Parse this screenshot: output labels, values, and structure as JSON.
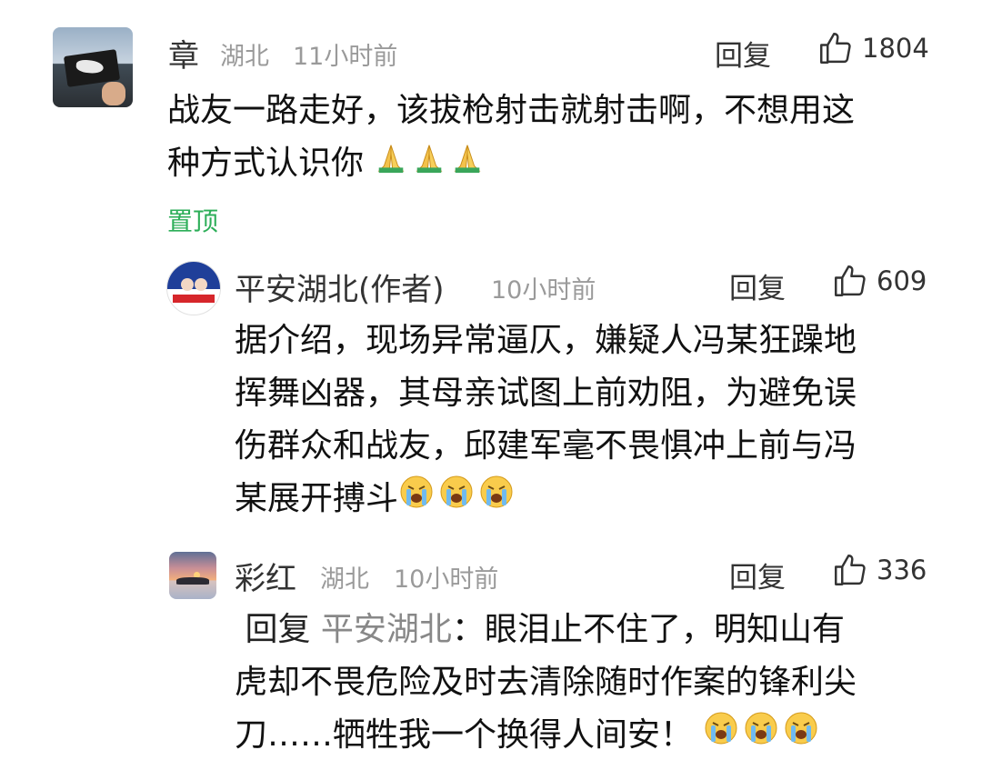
{
  "comments": [
    {
      "username": "章",
      "location": "湖北",
      "time": "11小时前",
      "reply_label": "回复",
      "likes": "1804",
      "content_lines": [
        "战友一路走好，该拔枪射击就射击啊，不想用这",
        "种方式认识你"
      ],
      "emoji": "pray-emoji",
      "emoji_count": 3,
      "pin_label": "置顶"
    },
    {
      "username": "平安湖北(作者)",
      "time": "10小时前",
      "reply_label": "回复",
      "likes": "609",
      "content_lines": [
        "据介绍，现场异常逼仄，嫌疑人冯某狂躁地",
        "挥舞凶器，其母亲试图上前劝阻，为避免误",
        "伤群众和战友，邱建军毫不畏惧冲上前与冯",
        "某展开搏斗"
      ],
      "emoji": "crying-face-emoji",
      "emoji_count": 3
    },
    {
      "username": "彩红",
      "location": "湖北",
      "time": "10小时前",
      "reply_label": "回复",
      "likes": "336",
      "reply_prefix": "回复",
      "mention": "平安湖北",
      "mention_sep": "：",
      "content_lines": [
        "眼泪止不住了，明知山有",
        "虎却不畏危险及时去清除随时作案的锋利尖",
        "刀……牺牲我一个换得人间安！"
      ],
      "emoji": "crying-face-emoji",
      "emoji_count": 3
    }
  ],
  "colors": {
    "pin": "#2cae58",
    "meta": "#9a9a9a",
    "text": "#111111"
  }
}
